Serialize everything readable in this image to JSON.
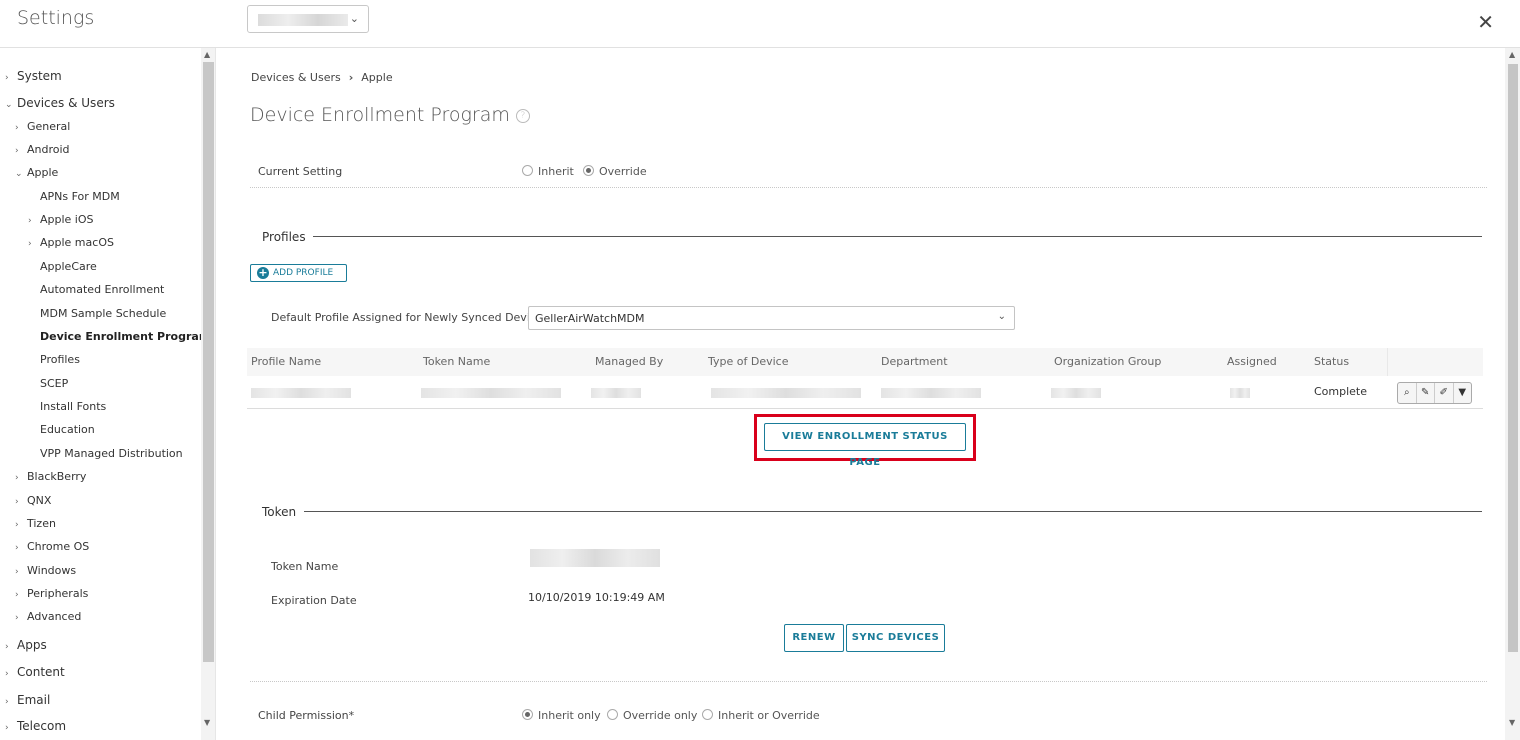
{
  "header": {
    "title": "Settings",
    "org_group_value": "",
    "close_label": "✕"
  },
  "sidebar": {
    "items": [
      {
        "label": "System",
        "level": 1,
        "chevron": "›"
      },
      {
        "label": "Devices & Users",
        "level": 1,
        "chevron": "⌄"
      },
      {
        "label": "General",
        "level": 2,
        "chevron": "›"
      },
      {
        "label": "Android",
        "level": 2,
        "chevron": "›"
      },
      {
        "label": "Apple",
        "level": 2,
        "chevron": "⌄"
      },
      {
        "label": "APNs For MDM",
        "level": 3
      },
      {
        "label": "Apple iOS",
        "level": 3,
        "chevron": "›"
      },
      {
        "label": "Apple macOS",
        "level": 3,
        "chevron": "›"
      },
      {
        "label": "AppleCare",
        "level": 3
      },
      {
        "label": "Automated Enrollment",
        "level": 3
      },
      {
        "label": "MDM Sample Schedule",
        "level": 3
      },
      {
        "label": "Device Enrollment Program",
        "level": 3,
        "active": true
      },
      {
        "label": "Profiles",
        "level": 3
      },
      {
        "label": "SCEP",
        "level": 3
      },
      {
        "label": "Install Fonts",
        "level": 3
      },
      {
        "label": "Education",
        "level": 3
      },
      {
        "label": "VPP Managed Distribution",
        "level": 3
      },
      {
        "label": "BlackBerry",
        "level": 2,
        "chevron": "›"
      },
      {
        "label": "QNX",
        "level": 2,
        "chevron": "›"
      },
      {
        "label": "Tizen",
        "level": 2,
        "chevron": "›"
      },
      {
        "label": "Chrome OS",
        "level": 2,
        "chevron": "›"
      },
      {
        "label": "Windows",
        "level": 2,
        "chevron": "›"
      },
      {
        "label": "Peripherals",
        "level": 2,
        "chevron": "›"
      },
      {
        "label": "Advanced",
        "level": 2,
        "chevron": "›"
      },
      {
        "label": "Apps",
        "level": 1,
        "chevron": "›"
      },
      {
        "label": "Content",
        "level": 1,
        "chevron": "›"
      },
      {
        "label": "Email",
        "level": 1,
        "chevron": "›"
      },
      {
        "label": "Telecom",
        "level": 1,
        "chevron": "›"
      }
    ]
  },
  "breadcrumb": {
    "parent": "Devices & Users",
    "separator": "›",
    "current": "Apple"
  },
  "page": {
    "title": "Device Enrollment Program",
    "help": "?"
  },
  "current_setting": {
    "label": "Current Setting",
    "options": [
      {
        "label": "Inherit",
        "checked": false
      },
      {
        "label": "Override",
        "checked": true
      }
    ]
  },
  "profiles": {
    "section_title": "Profiles",
    "add_button": "ADD PROFILE",
    "default_label": "Default Profile Assigned for Newly Synced Devices",
    "default_value": "GellerAirWatchMDM",
    "columns": [
      "Profile Name",
      "Token Name",
      "Managed By",
      "Type of Device",
      "Department",
      "Organization Group",
      "Assigned",
      "Status"
    ],
    "rows": [
      {
        "status": "Complete"
      }
    ],
    "view_status_button": "VIEW ENROLLMENT STATUS PAGE"
  },
  "token": {
    "section_title": "Token",
    "name_label": "Token Name",
    "expiration_label": "Expiration Date",
    "expiration_value": "10/10/2019 10:19:49 AM",
    "renew_button": "RENEW",
    "sync_button": "SYNC DEVICES"
  },
  "child_permission": {
    "label": "Child Permission*",
    "options": [
      {
        "label": "Inherit only",
        "checked": true
      },
      {
        "label": "Override only",
        "checked": false
      },
      {
        "label": "Inherit or Override",
        "checked": false
      }
    ]
  },
  "colors": {
    "accent": "#1a7c99",
    "highlight": "#d9001b"
  }
}
